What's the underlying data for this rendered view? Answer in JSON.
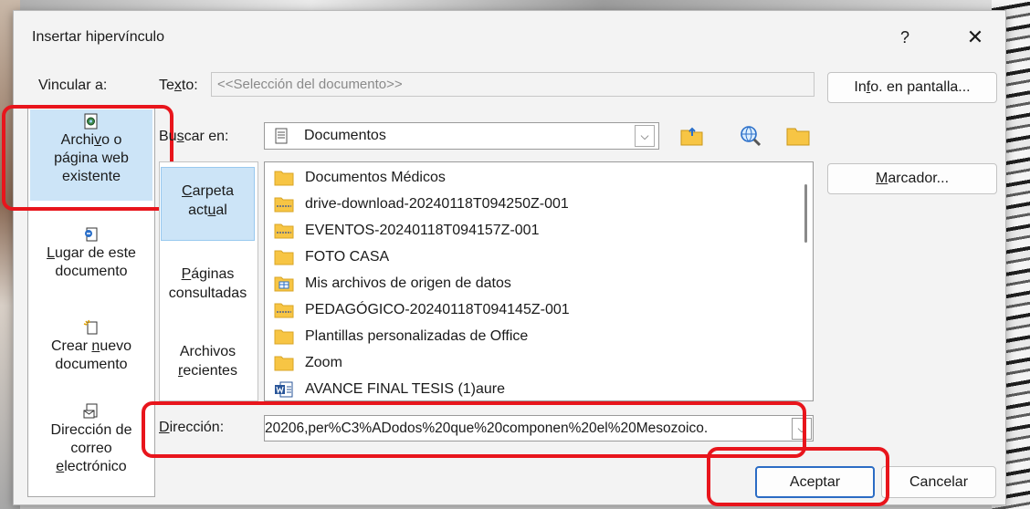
{
  "dialog": {
    "title": "Insertar hipervínculo",
    "help_label": "?",
    "close_label": "✕"
  },
  "link_to": {
    "label": "Vincular a:",
    "items": [
      {
        "label": "Archivo o página web existente",
        "lines": [
          "Archi",
          "v",
          "o o",
          "página web",
          "existente"
        ],
        "selected": true
      },
      {
        "label": "Lugar de este documento",
        "lines": [
          "L",
          "ugar de este",
          "documento"
        ]
      },
      {
        "label": "Crear nuevo documento",
        "lines": [
          "Crear ",
          "n",
          "uevo",
          "documento"
        ]
      },
      {
        "label": "Dirección de correo electrónico",
        "lines": [
          "Dirección de",
          "correo",
          "e",
          "lectrónico"
        ]
      }
    ]
  },
  "text_field": {
    "label_pre": "Te",
    "label_u": "x",
    "label_post": "to:",
    "value": "<<Selección del documento>>"
  },
  "screen_tip_button": {
    "pre": "In",
    "u": "f",
    "post": "o. en pantalla..."
  },
  "look_in": {
    "label_pre": "Bu",
    "label_u": "s",
    "label_post": "car en:",
    "value": "Documentos",
    "arrow": "⌵"
  },
  "bookmark_button": {
    "u": "M",
    "post": "arcador..."
  },
  "nav": {
    "items": [
      {
        "label": "Carpeta actual",
        "l1_pre": "",
        "l1_u": "C",
        "l1_post": "arpeta",
        "l2_pre": "act",
        "l2_u": "u",
        "l2_post": "al",
        "selected": true
      },
      {
        "label": "Páginas consultadas",
        "l1_pre": "",
        "l1_u": "P",
        "l1_post": "áginas",
        "l2_pre": "consultadas",
        "l2_u": "",
        "l2_post": ""
      },
      {
        "label": "Archivos recientes",
        "l1_pre": "Archivos",
        "l1_u": "",
        "l1_post": "",
        "l2_pre": "",
        "l2_u": "r",
        "l2_post": "ecientes"
      }
    ]
  },
  "files": [
    {
      "name": "Documentos Médicos",
      "icon": "folder-icon"
    },
    {
      "name": "drive-download-20240118T094250Z-001",
      "icon": "zip-folder-icon"
    },
    {
      "name": "EVENTOS-20240118T094157Z-001",
      "icon": "zip-folder-icon"
    },
    {
      "name": "FOTO CASA",
      "icon": "folder-icon"
    },
    {
      "name": "Mis archivos de origen de datos",
      "icon": "data-sources-folder-icon"
    },
    {
      "name": "PEDAGÓGICO-20240118T094145Z-001",
      "icon": "zip-folder-icon"
    },
    {
      "name": "Plantillas personalizadas de Office",
      "icon": "folder-icon"
    },
    {
      "name": "Zoom",
      "icon": "folder-icon"
    },
    {
      "name": "AVANCE FINAL TESIS (1)aure",
      "icon": "word-document-icon"
    }
  ],
  "address": {
    "label_pre": "",
    "label_u": "D",
    "label_post": "irección:",
    "value": "20206,per%C3%ADodos%20que%20componen%20el%20Mesozoico.",
    "arrow": "⌵"
  },
  "buttons": {
    "ok": "Aceptar",
    "cancel": "Cancelar"
  },
  "colors": {
    "highlight_red": "#e8151c",
    "selection_blue": "#cce4f7",
    "folder_yellow": "#f7c544",
    "primary_border": "#2b6cc4"
  }
}
